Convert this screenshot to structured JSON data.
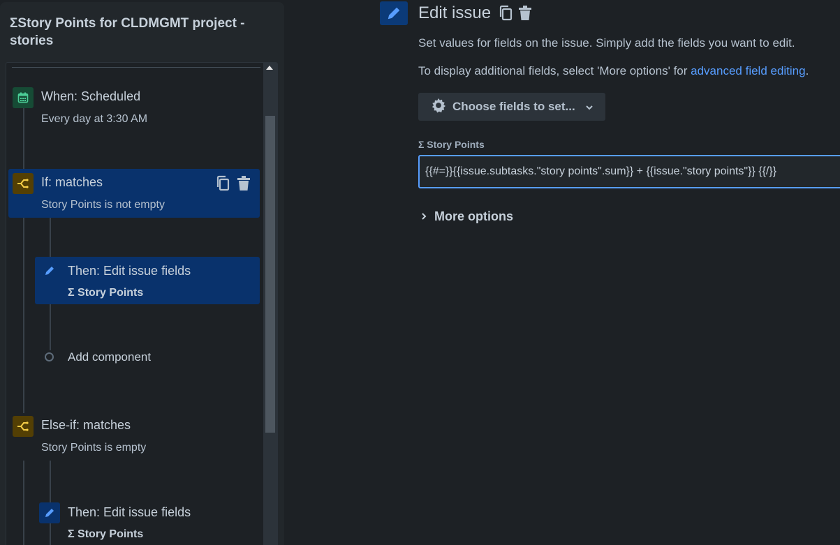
{
  "rule": {
    "title": "ΣStory Points for CLDMGMT project - stories"
  },
  "components": [
    {
      "type": "trigger",
      "title": "When: Scheduled",
      "subtitle": "Every day at 3:30 AM",
      "icon": "calendar-icon",
      "icon_color": "#1f845a"
    },
    {
      "type": "condition",
      "title": "If: matches",
      "subtitle": "Story Points is not empty",
      "icon": "branch-icon",
      "icon_color": "#e2b203",
      "selected": true
    },
    {
      "type": "action",
      "title": "Then: Edit issue fields",
      "subtitle": "Σ Story Points",
      "icon": "pencil-icon",
      "icon_color": "#579dff",
      "selected": true
    },
    {
      "type": "add",
      "title": "Add component"
    },
    {
      "type": "condition",
      "title": "Else-if: matches",
      "subtitle": "Story Points is empty",
      "icon": "branch-icon",
      "icon_color": "#e2b203"
    },
    {
      "type": "action",
      "title": "Then: Edit issue fields",
      "subtitle": "Σ Story Points",
      "icon": "pencil-icon",
      "icon_color": "#579dff"
    }
  ],
  "editor": {
    "title": "Edit issue",
    "description": "Set values for fields on the issue. Simply add the fields you want to edit.",
    "hint_prefix": "To display additional fields, select 'More options' for ",
    "hint_link": "advanced field editing",
    "hint_suffix": ".",
    "choose_fields_label": "Choose fields to set...",
    "field_label": "Σ Story Points",
    "field_value": "{{#=}}{{issue.subtasks.\"story points\".sum}} + {{issue.\"story points\"}} {{/}}",
    "more_options_label": "More options"
  },
  "colors": {
    "background": "#1d2125",
    "panel": "#22272b",
    "selected": "#09326c",
    "link": "#579dff",
    "trigger_green": "#1f845a",
    "condition_yellow": "#e2b203"
  }
}
